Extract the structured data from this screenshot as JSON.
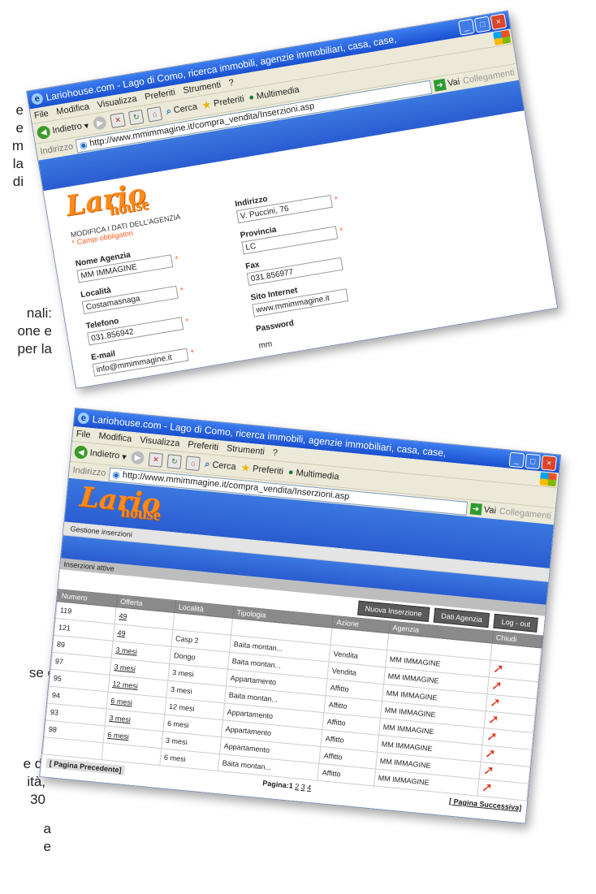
{
  "doc_fragments": {
    "frag1": [
      "e",
      "e",
      "m",
      "la",
      "di"
    ],
    "frag2": [
      "nali:",
      "one e",
      "per la"
    ],
    "frag3": [
      "se è"
    ],
    "frag4": [
      "e di",
      "ità,",
      "30"
    ],
    "frag5": [
      "a",
      "e"
    ]
  },
  "window1": {
    "title": "Lariohouse.com - Lago di Como, ricerca immobili, agenzie immobiliari, casa, case,",
    "menu": [
      "File",
      "Modifica",
      "Visualizza",
      "Preferiti",
      "Strumenti",
      "?"
    ],
    "toolbar": {
      "back": "Indietro",
      "search": "Cerca",
      "favorites": "Preferiti",
      "multimedia": "Multimedia"
    },
    "address_label": "Indirizzo",
    "url": "http://www.mmimmagine.it/compra_vendita/Inserzioni.asp",
    "go": "Vai",
    "links": "Collegamenti",
    "logo_main": "Lario",
    "logo_sub": "house",
    "form": {
      "title": "MODIFICA I DATI DELL'AGENZIA",
      "note": "* Campi obbligatori",
      "left": [
        {
          "label": "Nome Agenzia",
          "value": "MM IMMAGINE"
        },
        {
          "label": "Località",
          "value": "Costamasnaga"
        },
        {
          "label": "Telefono",
          "value": "031.856942"
        },
        {
          "label": "E-mail",
          "value": "info@mmimmagine.it"
        }
      ],
      "right": [
        {
          "label": "Indirizzo",
          "value": "V. Puccini, 76"
        },
        {
          "label": "Provincia",
          "value": "LC"
        },
        {
          "label": "Fax",
          "value": "031.856977"
        },
        {
          "label": "Sito Internet",
          "value": "www.mmimmagine.it"
        }
      ],
      "password_label": "Password",
      "password_value": "mm",
      "required_mark": "*"
    }
  },
  "window2": {
    "title": "Lariohouse.com - Lago di Como, ricerca immobili, agenzie immobiliari, casa, case,",
    "menu": [
      "File",
      "Modifica",
      "Visualizza",
      "Preferiti",
      "Strumenti",
      "?"
    ],
    "toolbar": {
      "back": "Indietro",
      "search": "Cerca",
      "favorites": "Preferiti",
      "multimedia": "Multimedia"
    },
    "address_label": "Indirizzo",
    "url": "http://www.mmimmagine.it/compra_vendita/Inserzioni.asp",
    "go": "Vai",
    "links": "Collegamenti",
    "logo_main": "Lario",
    "logo_sub": "house",
    "subbar": "Gestione inserzioni",
    "section": "Inserzioni attive",
    "buttons": [
      "Nuova Inserzione",
      "Dati Agenzia",
      "Log - out"
    ],
    "columns": [
      "Numero",
      "Offerta",
      "Località",
      "Tipologia",
      "Azione",
      "Agenzia",
      "Chiudi"
    ],
    "rows": [
      {
        "numero": "119",
        "offerta": "49",
        "localita": "",
        "tipologia": "",
        "azione": "",
        "agenzia": ""
      },
      {
        "numero": "121",
        "offerta": "49",
        "localita": "Casp 2",
        "tipologia": "Baita montan...",
        "azione": "Vendita",
        "agenzia": "MM IMMAGINE"
      },
      {
        "numero": "89",
        "offerta": "3 mesi",
        "localita": "Dongo",
        "tipologia": "Baita montan...",
        "azione": "Vendita",
        "agenzia": "MM IMMAGINE"
      },
      {
        "numero": "97",
        "offerta": "3 mesi",
        "localita": "3 mesi",
        "tipologia": "Appartamento",
        "azione": "Affitto",
        "agenzia": "MM IMMAGINE"
      },
      {
        "numero": "95",
        "offerta": "12 mesi",
        "localita": "3 mesi",
        "tipologia": "Baita montan...",
        "azione": "Affitto",
        "agenzia": "MM IMMAGINE"
      },
      {
        "numero": "94",
        "offerta": "6 mesi",
        "localita": "12 mesi",
        "tipologia": "Appartamento",
        "azione": "Affitto",
        "agenzia": "MM IMMAGINE"
      },
      {
        "numero": "93",
        "offerta": "3 mesi",
        "localita": "6 mesi",
        "tipologia": "Appartamento",
        "azione": "Affitto",
        "agenzia": "MM IMMAGINE"
      },
      {
        "numero": "98",
        "offerta": "6 mesi",
        "localita": "3 mesi",
        "tipologia": "Appartamento",
        "azione": "Affitto",
        "agenzia": "MM IMMAGINE"
      },
      {
        "numero": "",
        "offerta": "",
        "localita": "6 mesi",
        "tipologia": "Baita montan...",
        "azione": "Affitto",
        "agenzia": "MM IMMAGINE"
      }
    ],
    "prev_page": "[ Pagina Precedente]",
    "page_label": "Pagina:",
    "pages": [
      "1",
      "2",
      "3",
      "4"
    ],
    "next_page": "[ Pagina Successiva]"
  }
}
